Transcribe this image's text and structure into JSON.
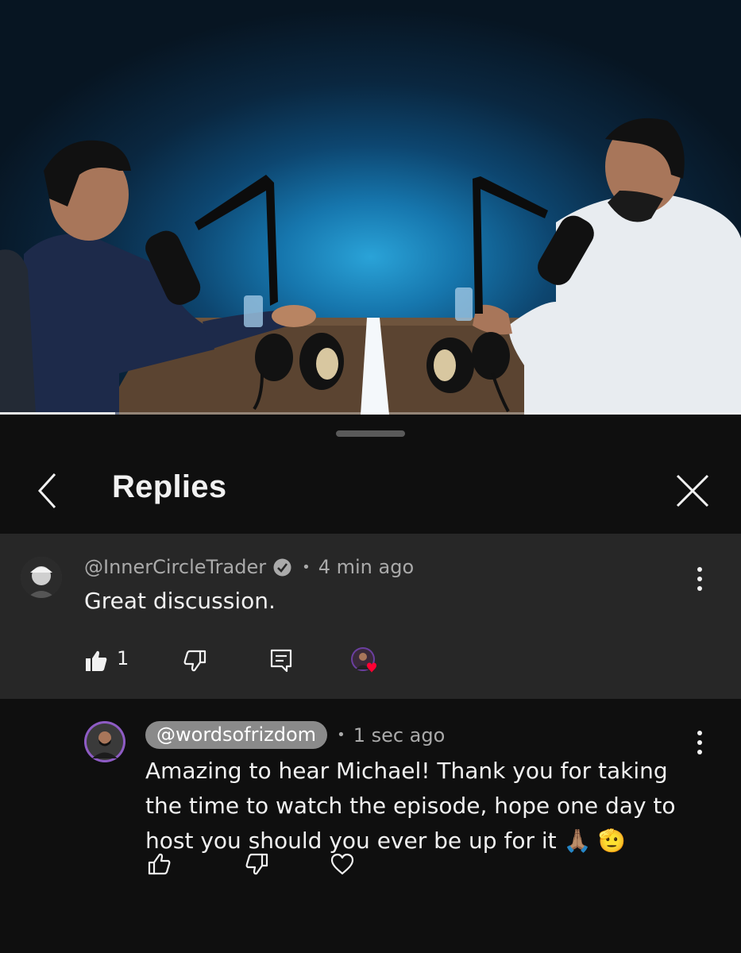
{
  "video": {
    "progress_fraction": 0.155
  },
  "sheet": {
    "title": "Replies",
    "back_icon": "chevron-left-icon",
    "close_icon": "close-icon"
  },
  "parent_comment": {
    "author": "@InnerCircleTrader",
    "verified": true,
    "time": "4 min ago",
    "text": "Great discussion.",
    "like_count": "1",
    "creator_hearted": true
  },
  "reply": {
    "author": "@wordsofrizdom",
    "time": "1 sec ago",
    "text": "Amazing to hear Michael! Thank you for taking the time to watch the episode, hope one day to host you should you ever be up for it 🙏🏽 🫡"
  },
  "colors": {
    "background": "#0f0f0f",
    "parent_background": "#272727",
    "text_primary": "#f1f1f1",
    "text_secondary": "#aaaaaa",
    "heart": "#ff0033"
  }
}
